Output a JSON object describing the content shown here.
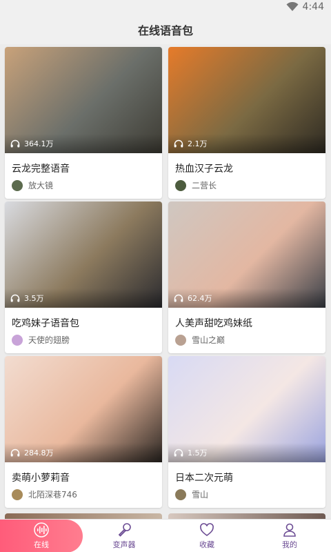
{
  "status": {
    "time": "4:44"
  },
  "header": {
    "title": "在线语音包"
  },
  "cards": [
    {
      "title": "云龙完整语音",
      "plays": "364.1万",
      "author": "放大镜",
      "thumb_colors": [
        "#c9a27a",
        "#6b6f6a",
        "#3d3b33"
      ],
      "avatar_color": "#5c6b4e"
    },
    {
      "title": "热血汉子云龙",
      "plays": "2.1万",
      "author": "二营长",
      "thumb_colors": [
        "#e67b2a",
        "#7b6a43",
        "#2e2a22"
      ],
      "avatar_color": "#4d5c3e"
    },
    {
      "title": "吃鸡妹子语音包",
      "plays": "3.5万",
      "author": "天使的翅膀",
      "thumb_colors": [
        "#d9dbe0",
        "#8c7a5e",
        "#2b2b2f"
      ],
      "avatar_color": "#c8a3d8"
    },
    {
      "title": "人美声甜吃鸡妹纸",
      "plays": "62.4万",
      "author": "雪山之巅",
      "thumb_colors": [
        "#cfc7c1",
        "#e3b7a2",
        "#3a3f47"
      ],
      "avatar_color": "#b9a192"
    },
    {
      "title": "卖萌小萝莉音",
      "plays": "284.8万",
      "author": "北陌深巷746",
      "thumb_colors": [
        "#f2dcd0",
        "#e9b89d",
        "#2b2622"
      ],
      "avatar_color": "#a88b5a"
    },
    {
      "title": "日本二次元萌",
      "plays": "1.5万",
      "author": "雪山",
      "thumb_colors": [
        "#d8daf4",
        "#f4e7e4",
        "#9aa3df"
      ],
      "avatar_color": "#8a7a5a"
    }
  ],
  "tabs": [
    {
      "label": "在线",
      "icon": "soundwave-icon",
      "active": true
    },
    {
      "label": "变声器",
      "icon": "microphone-icon",
      "active": false
    },
    {
      "label": "收藏",
      "icon": "heart-icon",
      "active": false
    },
    {
      "label": "我的",
      "icon": "user-icon",
      "active": false
    }
  ],
  "colors": {
    "accent": "#ff5c7a",
    "tab_label": "#6b4b93"
  }
}
